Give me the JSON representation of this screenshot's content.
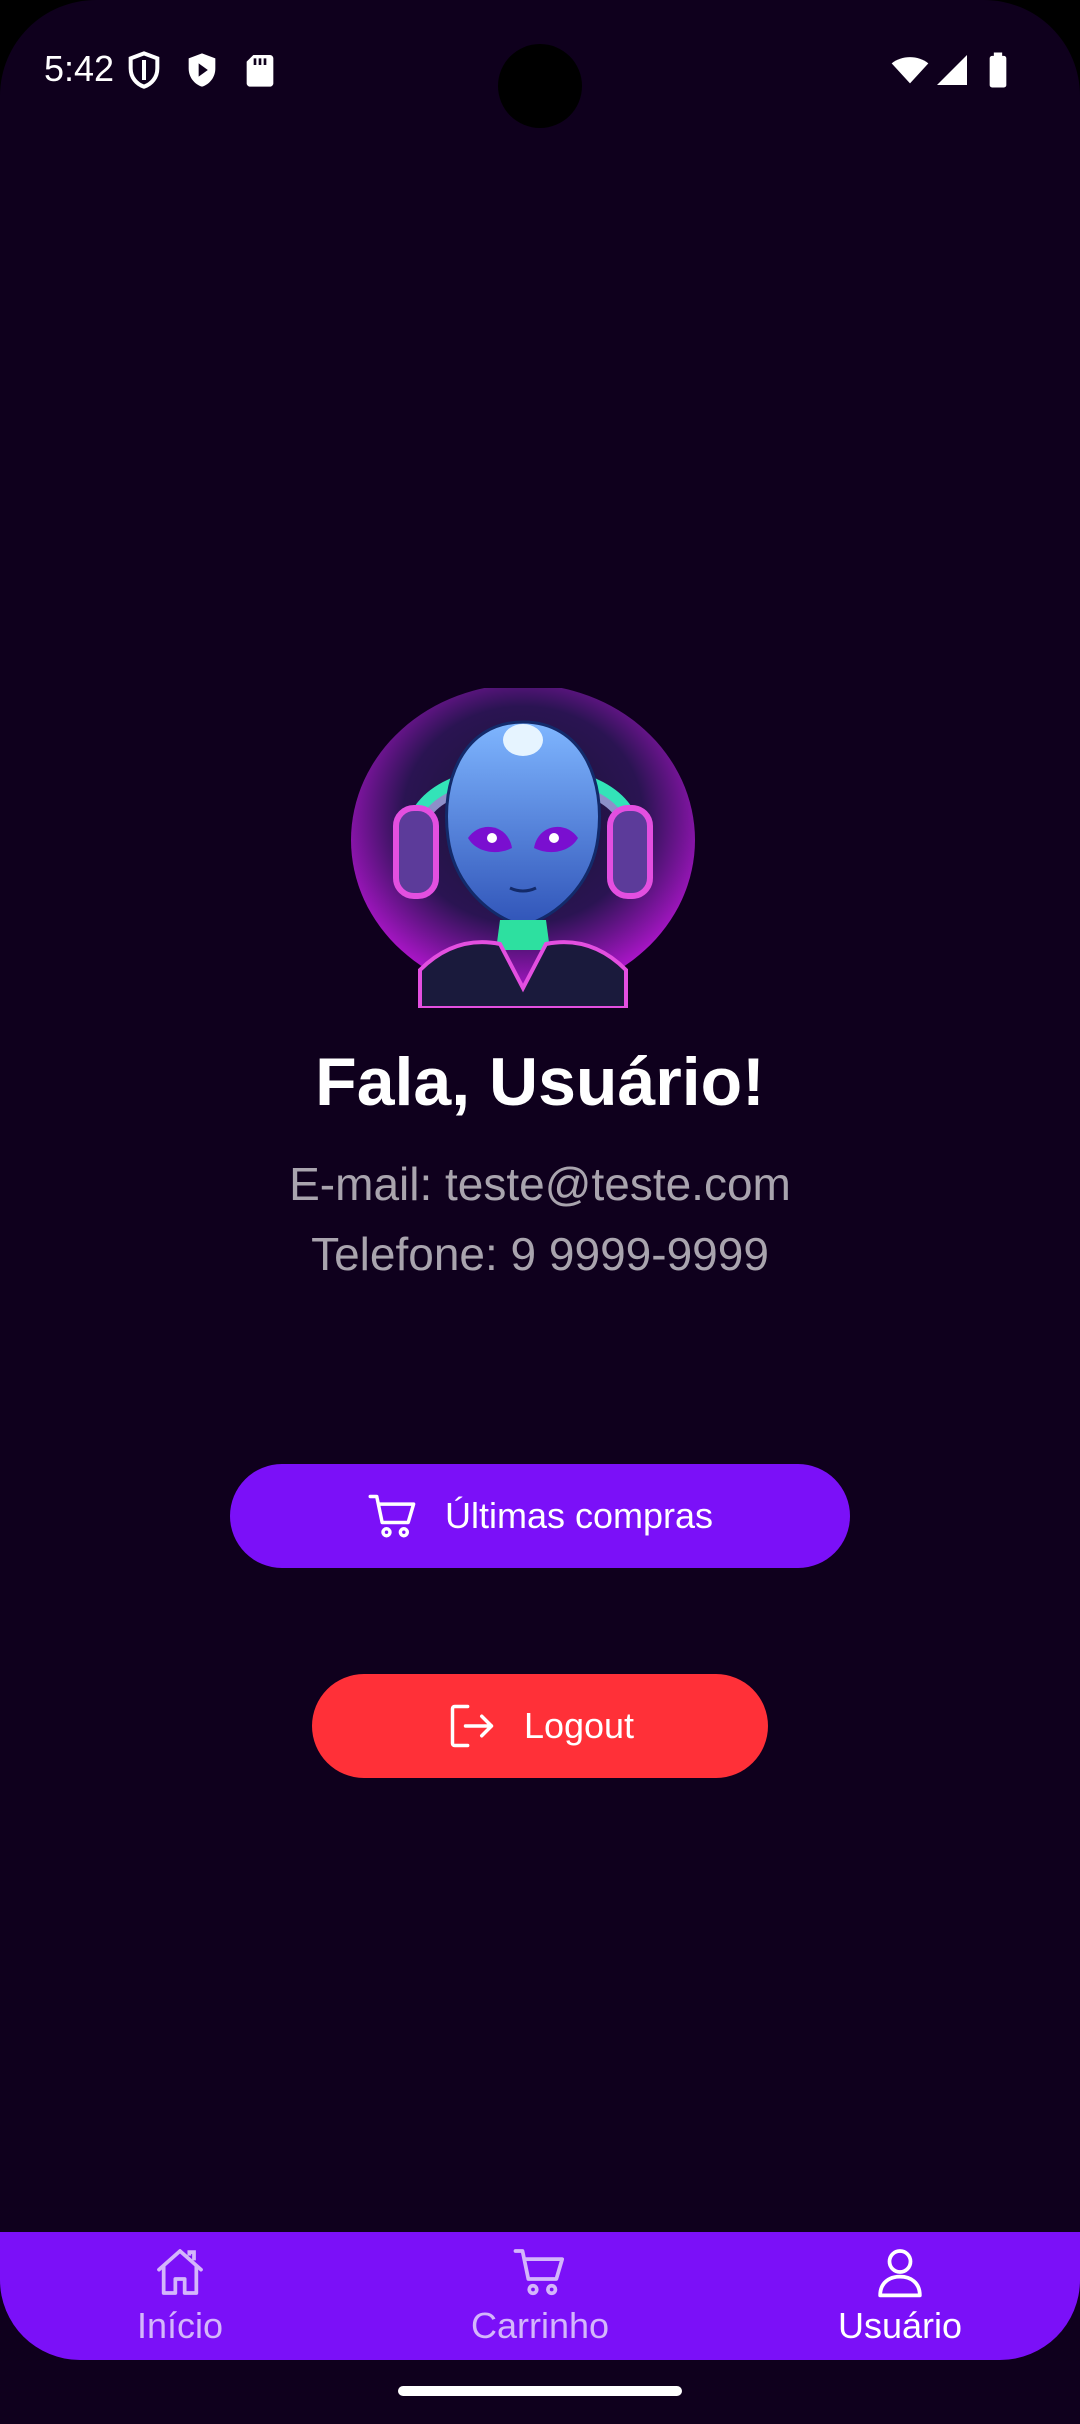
{
  "status_bar": {
    "time": "5:42",
    "left_icons": [
      "shield-icon",
      "play-protect-icon",
      "sd-card-icon"
    ],
    "right_icons": [
      "wifi-icon",
      "signal-icon",
      "battery-icon"
    ]
  },
  "profile": {
    "avatar": "alien-headphones-avatar",
    "greeting": "Fala, Usuário!",
    "email_line": "E-mail: teste@teste.com",
    "phone_line": "Telefone: 9 9999-9999"
  },
  "actions": {
    "purchases_label": "Últimas compras",
    "purchases_icon": "cart-icon",
    "logout_label": "Logout",
    "logout_icon": "logout-icon"
  },
  "bottom_nav": {
    "items": [
      {
        "label": "Início",
        "icon": "home-icon",
        "active": false
      },
      {
        "label": "Carrinho",
        "icon": "cart-icon",
        "active": false
      },
      {
        "label": "Usuário",
        "icon": "user-icon",
        "active": true
      }
    ]
  },
  "colors": {
    "background": "#0f001d",
    "accent": "#7b10f8",
    "danger": "#ff3038",
    "muted_text": "#a9a4ae",
    "nav_inactive": "#d4b6fb"
  }
}
